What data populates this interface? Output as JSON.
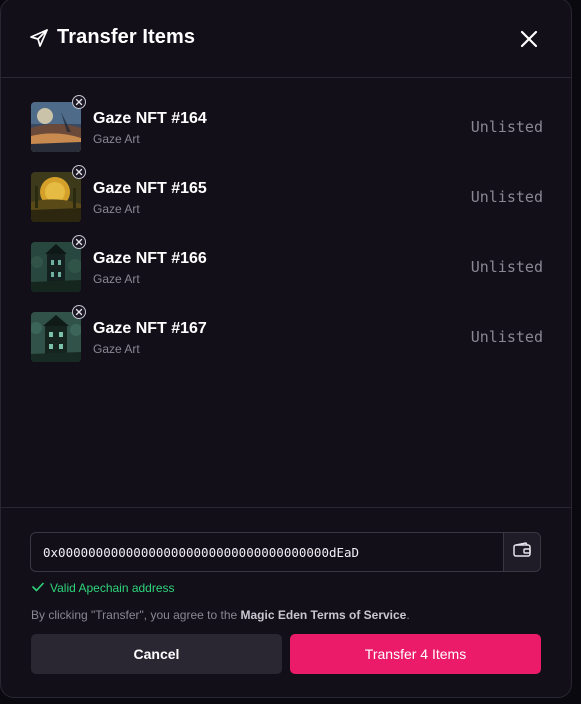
{
  "modal": {
    "title": "Transfer Items",
    "icons": {
      "send": "send-icon",
      "close": "close-icon",
      "remove": "remove-icon",
      "wallet": "wallet-icon",
      "check": "check-icon"
    }
  },
  "items": [
    {
      "name": "Gaze NFT #164",
      "collection": "Gaze Art",
      "status": "Unlisted"
    },
    {
      "name": "Gaze NFT #165",
      "collection": "Gaze Art",
      "status": "Unlisted"
    },
    {
      "name": "Gaze NFT #166",
      "collection": "Gaze Art",
      "status": "Unlisted"
    },
    {
      "name": "Gaze NFT #167",
      "collection": "Gaze Art",
      "status": "Unlisted"
    }
  ],
  "form": {
    "address_value": "0x000000000000000000000000000000000000dEaD",
    "validation_text": "Valid Apechain address",
    "terms_prefix": "By clicking \"Transfer\", you agree to the ",
    "terms_link": "Magic Eden Terms of Service",
    "terms_suffix": ".",
    "cancel_label": "Cancel",
    "transfer_label": "Transfer 4 Items"
  },
  "colors": {
    "background": "#120f19",
    "accent": "#ec1b6a",
    "success": "#2ed47a",
    "muted_text": "#8a8793",
    "cancel_button": "#2a2733"
  }
}
